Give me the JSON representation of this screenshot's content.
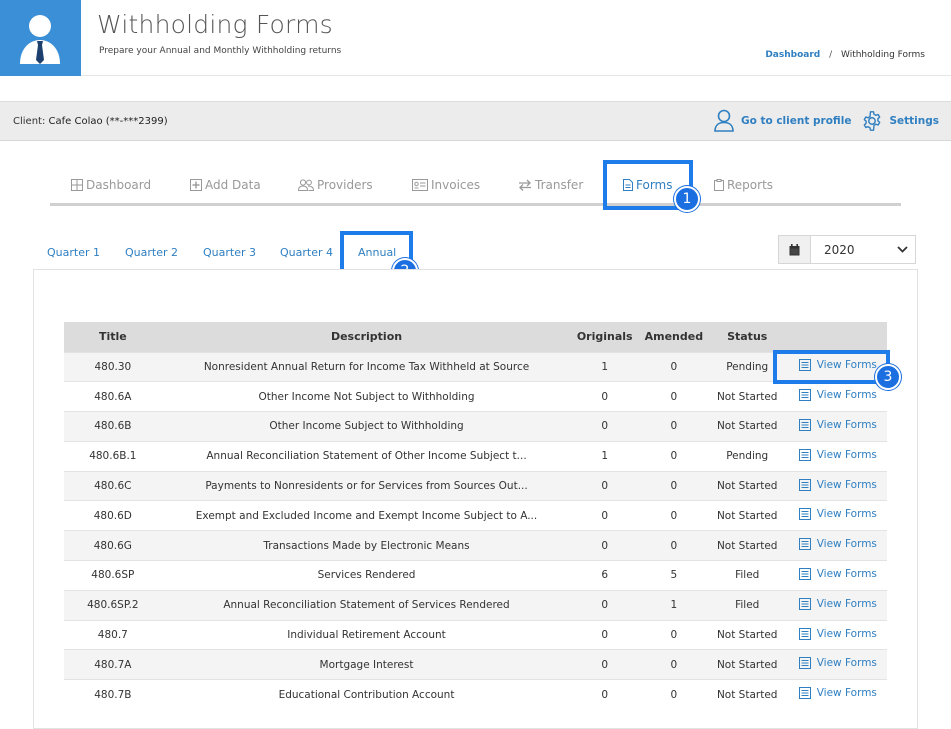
{
  "header": {
    "title": "Withholding Forms",
    "subtitle": "Prepare your Annual and Monthly Withholding returns",
    "breadcrumb": {
      "home": "Dashboard",
      "separator": "/",
      "current": "Withholding Forms"
    }
  },
  "client_bar": {
    "label": "Client:",
    "client_name": "Cafe Colao (**-***2399)",
    "profile_link": "Go to client profile",
    "settings_link": "Settings"
  },
  "main_tabs": [
    {
      "label": "Dashboard",
      "icon": "grid-icon"
    },
    {
      "label": "Add Data",
      "icon": "plus-square-icon"
    },
    {
      "label": "Providers",
      "icon": "users-icon"
    },
    {
      "label": "Invoices",
      "icon": "id-card-icon"
    },
    {
      "label": "Transfer",
      "icon": "exchange-icon"
    },
    {
      "label": "Forms",
      "icon": "file-icon",
      "active": true
    },
    {
      "label": "Reports",
      "icon": "clipboard-icon"
    }
  ],
  "sub_tabs": [
    "Quarter 1",
    "Quarter 2",
    "Quarter 3",
    "Quarter 4",
    "Annual"
  ],
  "active_sub_tab": "Annual",
  "year_select": {
    "value": "2020"
  },
  "annotations": [
    "1",
    "2",
    "3"
  ],
  "table": {
    "headers": [
      "Title",
      "Description",
      "Originals",
      "Amended",
      "Status",
      ""
    ],
    "view_label": "View Forms",
    "rows": [
      {
        "title": "480.30",
        "description": "Nonresident Annual Return for Income Tax Withheld at Source",
        "originals": "1",
        "amended": "0",
        "status": "Pending"
      },
      {
        "title": "480.6A",
        "description": "Other Income Not Subject to Withholding",
        "originals": "0",
        "amended": "0",
        "status": "Not Started"
      },
      {
        "title": "480.6B",
        "description": "Other Income Subject to Withholding",
        "originals": "0",
        "amended": "0",
        "status": "Not Started"
      },
      {
        "title": "480.6B.1",
        "description": "Annual Reconciliation Statement of Other Income Subject t...",
        "originals": "1",
        "amended": "0",
        "status": "Pending"
      },
      {
        "title": "480.6C",
        "description": "Payments to Nonresidents or for Services from Sources Out...",
        "originals": "0",
        "amended": "0",
        "status": "Not Started"
      },
      {
        "title": "480.6D",
        "description": "Exempt and Excluded Income and Exempt Income Subject to A...",
        "originals": "0",
        "amended": "0",
        "status": "Not Started"
      },
      {
        "title": "480.6G",
        "description": "Transactions Made by Electronic Means",
        "originals": "0",
        "amended": "0",
        "status": "Not Started"
      },
      {
        "title": "480.6SP",
        "description": "Services Rendered",
        "originals": "6",
        "amended": "5",
        "status": "Filed"
      },
      {
        "title": "480.6SP.2",
        "description": "Annual Reconciliation Statement of Services Rendered",
        "originals": "0",
        "amended": "1",
        "status": "Filed"
      },
      {
        "title": "480.7",
        "description": "Individual Retirement Account",
        "originals": "0",
        "amended": "0",
        "status": "Not Started"
      },
      {
        "title": "480.7A",
        "description": "Mortgage Interest",
        "originals": "0",
        "amended": "0",
        "status": "Not Started"
      },
      {
        "title": "480.7B",
        "description": "Educational Contribution Account",
        "originals": "0",
        "amended": "0",
        "status": "Not Started"
      }
    ]
  },
  "colors": {
    "accent": "#2f7fc1",
    "highlight": "#1e7bea",
    "avatar_bg": "#3a8fd6"
  }
}
